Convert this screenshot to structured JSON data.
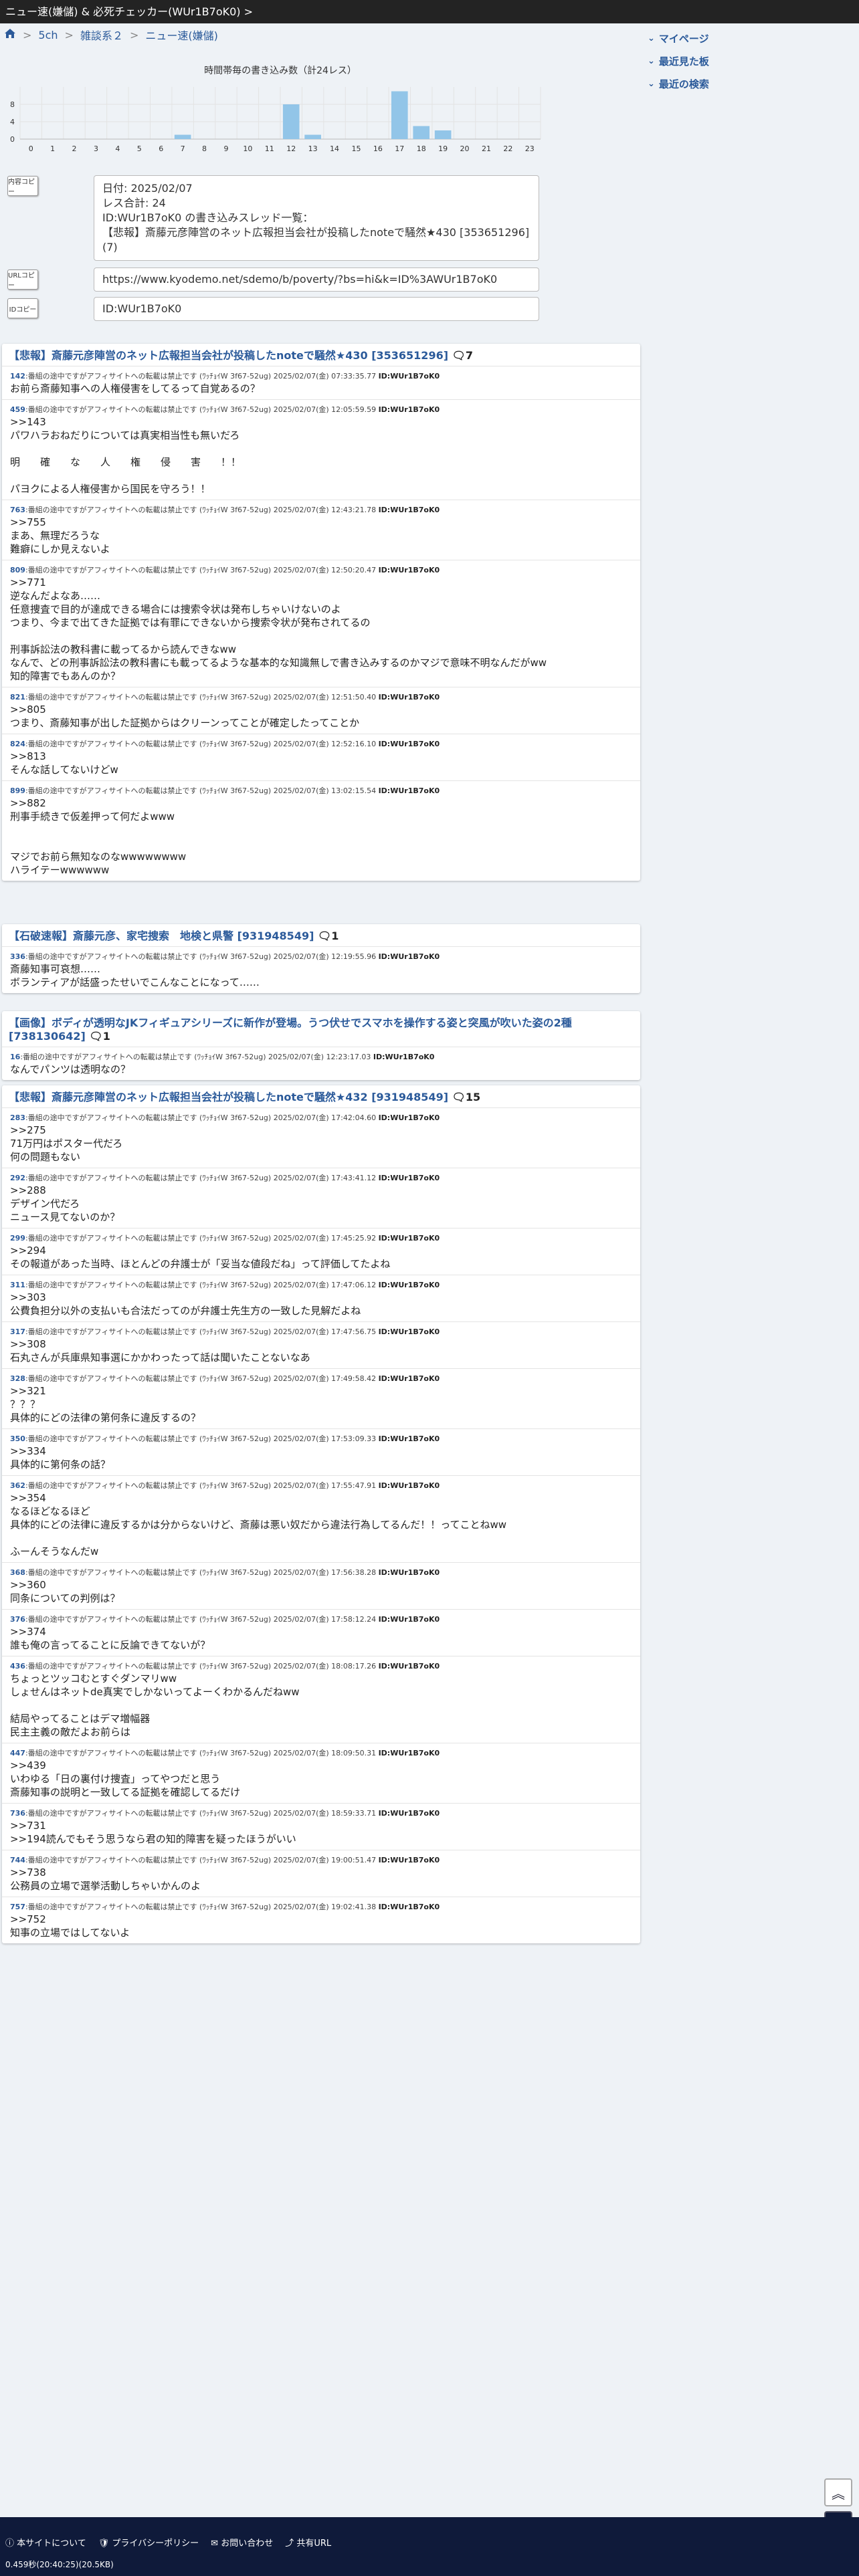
{
  "window": {
    "title": "ニュー速(嫌儲) & 必死チェッカー(WUr1B7oK0) >"
  },
  "breadcrumb": {
    "home_icon": "home-icon",
    "items": [
      "5ch",
      "雑談系２",
      "ニュー速(嫌儲)"
    ]
  },
  "rightmenu": {
    "items": [
      "マイページ",
      "最近見た板",
      "最近の検索"
    ]
  },
  "chart_data": {
    "type": "bar",
    "title": "時間帯毎の書き込み数（計24レス）",
    "categories": [
      "0",
      "1",
      "2",
      "3",
      "4",
      "5",
      "6",
      "7",
      "8",
      "9",
      "10",
      "11",
      "12",
      "13",
      "14",
      "15",
      "16",
      "17",
      "18",
      "19",
      "20",
      "21",
      "22",
      "23"
    ],
    "values": [
      0,
      0,
      0,
      0,
      0,
      0,
      0,
      1,
      0,
      0,
      0,
      0,
      8,
      1,
      0,
      0,
      0,
      11,
      3,
      2,
      0,
      0,
      0,
      0
    ],
    "yticks": [
      "0",
      "4",
      "8"
    ],
    "ylim": [
      0,
      12
    ],
    "grid": true
  },
  "tools": {
    "summary_icon": "内容コピー",
    "url_icon": "URLコピー",
    "id_icon": "IDコピー"
  },
  "summary": {
    "lines": [
      "日付: 2025/02/07",
      "レス合計: 24",
      "ID:WUr1B7oK0 の書き込みスレッド一覧：",
      "【悲報】斎藤元彦陣営のネット広報担当会社が投稿したnoteで騒然★430 [353651296] (7)"
    ]
  },
  "url": "https://www.kyodemo.net/sdemo/b/poverty/?bs=hi&k=ID%3AWUr1B7oK0",
  "id": "ID:WUr1B7oK0",
  "threads": [
    {
      "title": "【悲報】斎藤元彦陣営のネット広報担当会社が投稿したnoteで騒然★430 [353651296]",
      "count": "7",
      "posts": [
        {
          "num": "142",
          "meta": ":番組の途中ですがアフィサイトへの転載は禁止です (ﾜｯﾁｮｲW 3f67-52ug) 2025/02/07(金) 07:33:35.77",
          "pid": "ID:WUr1B7oK0",
          "body": "お前ら斎藤知事への人権侵害をしてるって自覚あるの？"
        },
        {
          "num": "459",
          "meta": ":番組の途中ですがアフィサイトへの転載は禁止です (ﾜｯﾁｮｲW 3f67-52ug) 2025/02/07(金) 12:05:59.59",
          "pid": "ID:WUr1B7oK0",
          "body": ">>143\nパワハラおねだりについては真実相当性も無いだろ\n\n明　　確　　な　　人　　権　　侵　　害　　！！\n\nパヨクによる人権侵害から国民を守ろう！！"
        },
        {
          "num": "763",
          "meta": ":番組の途中ですがアフィサイトへの転載は禁止です (ﾜｯﾁｮｲW 3f67-52ug) 2025/02/07(金) 12:43:21.78",
          "pid": "ID:WUr1B7oK0",
          "body": ">>755\nまあ、無理だろうな\n難癖にしか見えないよ"
        },
        {
          "num": "809",
          "meta": ":番組の途中ですがアフィサイトへの転載は禁止です (ﾜｯﾁｮｲW 3f67-52ug) 2025/02/07(金) 12:50:20.47",
          "pid": "ID:WUr1B7oK0",
          "body": ">>771\n逆なんだよなあ……\n任意捜査で目的が達成できる場合には捜索令状は発布しちゃいけないのよ\nつまり、今まで出てきた証拠では有罪にできないから捜索令状が発布されてるの\n\n刑事訴訟法の教科書に載ってるから読んできなww\nなんで、どの刑事訴訟法の教科書にも載ってるような基本的な知識無しで書き込みするのかマジで意味不明なんだがww\n知的障害でもあんのか？"
        },
        {
          "num": "821",
          "meta": ":番組の途中ですがアフィサイトへの転載は禁止です (ﾜｯﾁｮｲW 3f67-52ug) 2025/02/07(金) 12:51:50.40",
          "pid": "ID:WUr1B7oK0",
          "body": ">>805\nつまり、斎藤知事が出した証拠からはクリーンってことが確定したってことか"
        },
        {
          "num": "824",
          "meta": ":番組の途中ですがアフィサイトへの転載は禁止です (ﾜｯﾁｮｲW 3f67-52ug) 2025/02/07(金) 12:52:16.10",
          "pid": "ID:WUr1B7oK0",
          "body": ">>813\nそんな話してないけどw"
        },
        {
          "num": "899",
          "meta": ":番組の途中ですがアフィサイトへの転載は禁止です (ﾜｯﾁｮｲW 3f67-52ug) 2025/02/07(金) 13:02:15.54",
          "pid": "ID:WUr1B7oK0",
          "body": ">>882\n刑事手続きで仮差押って何だよwww\n\n\nマジでお前ら無知なのなwwwwwwww\nハライテーwwwwww"
        }
      ]
    },
    {
      "title": "【石破速報】斎藤元彦、家宅捜索　地検と県警 [931948549]",
      "count": "1",
      "posts": [
        {
          "num": "336",
          "meta": ":番組の途中ですがアフィサイトへの転載は禁止です (ﾜｯﾁｮｲW 3f67-52ug) 2025/02/07(金) 12:19:55.96",
          "pid": "ID:WUr1B7oK0",
          "body": "斎藤知事可哀想……\nボランティアが話盛ったせいでこんなことになって……"
        }
      ]
    },
    {
      "title": "【画像】ボディが透明なJKフィギュアシリーズに新作が登場。うつ伏せでスマホを操作する姿と突風が吹いた姿の2種 [738130642]",
      "count": "1",
      "posts": [
        {
          "num": "16",
          "meta": ":番組の途中ですがアフィサイトへの転載は禁止です (ﾜｯﾁｮｲW 3f67-52ug) 2025/02/07(金) 12:23:17.03",
          "pid": "ID:WUr1B7oK0",
          "body": "なんでパンツは透明なの？"
        }
      ]
    },
    {
      "title": "【悲報】斎藤元彦陣営のネット広報担当会社が投稿したnoteで騒然★432 [931948549]",
      "count": "15",
      "posts": [
        {
          "num": "283",
          "meta": ":番組の途中ですがアフィサイトへの転載は禁止です (ﾜｯﾁｮｲW 3f67-52ug) 2025/02/07(金) 17:42:04.60",
          "pid": "ID:WUr1B7oK0",
          "body": ">>275\n71万円はポスター代だろ\n何の問題もない"
        },
        {
          "num": "292",
          "meta": ":番組の途中ですがアフィサイトへの転載は禁止です (ﾜｯﾁｮｲW 3f67-52ug) 2025/02/07(金) 17:43:41.12",
          "pid": "ID:WUr1B7oK0",
          "body": ">>288\nデザイン代だろ\nニュース見てないのか？"
        },
        {
          "num": "299",
          "meta": ":番組の途中ですがアフィサイトへの転載は禁止です (ﾜｯﾁｮｲW 3f67-52ug) 2025/02/07(金) 17:45:25.92",
          "pid": "ID:WUr1B7oK0",
          "body": ">>294\nその報道があった当時、ほとんどの弁護士が「妥当な値段だね」って評価してたよね"
        },
        {
          "num": "311",
          "meta": ":番組の途中ですがアフィサイトへの転載は禁止です (ﾜｯﾁｮｲW 3f67-52ug) 2025/02/07(金) 17:47:06.12",
          "pid": "ID:WUr1B7oK0",
          "body": ">>303\n公費負担分以外の支払いも合法だってのが弁護士先生方の一致した見解だよね"
        },
        {
          "num": "317",
          "meta": ":番組の途中ですがアフィサイトへの転載は禁止です (ﾜｯﾁｮｲW 3f67-52ug) 2025/02/07(金) 17:47:56.75",
          "pid": "ID:WUr1B7oK0",
          "body": ">>308\n石丸さんが兵庫県知事選にかかわったって話は聞いたことないなあ"
        },
        {
          "num": "328",
          "meta": ":番組の途中ですがアフィサイトへの転載は禁止です (ﾜｯﾁｮｲW 3f67-52ug) 2025/02/07(金) 17:49:58.42",
          "pid": "ID:WUr1B7oK0",
          "body": ">>321\n？？？\n具体的にどの法律の第何条に違反するの？"
        },
        {
          "num": "350",
          "meta": ":番組の途中ですがアフィサイトへの転載は禁止です (ﾜｯﾁｮｲW 3f67-52ug) 2025/02/07(金) 17:53:09.33",
          "pid": "ID:WUr1B7oK0",
          "body": ">>334\n具体的に第何条の話？"
        },
        {
          "num": "362",
          "meta": ":番組の途中ですがアフィサイトへの転載は禁止です (ﾜｯﾁｮｲW 3f67-52ug) 2025/02/07(金) 17:55:47.91",
          "pid": "ID:WUr1B7oK0",
          "body": ">>354\nなるほどなるほど\n具体的にどの法律に違反するかは分からないけど、斎藤は悪い奴だから違法行為してるんだ！！ってことねww\n\nふーんそうなんだw"
        },
        {
          "num": "368",
          "meta": ":番組の途中ですがアフィサイトへの転載は禁止です (ﾜｯﾁｮｲW 3f67-52ug) 2025/02/07(金) 17:56:38.28",
          "pid": "ID:WUr1B7oK0",
          "body": ">>360\n同条についての判例は？"
        },
        {
          "num": "376",
          "meta": ":番組の途中ですがアフィサイトへの転載は禁止です (ﾜｯﾁｮｲW 3f67-52ug) 2025/02/07(金) 17:58:12.24",
          "pid": "ID:WUr1B7oK0",
          "body": ">>374\n誰も俺の言ってることに反論できてないが？"
        },
        {
          "num": "436",
          "meta": ":番組の途中ですがアフィサイトへの転載は禁止です (ﾜｯﾁｮｲW 3f67-52ug) 2025/02/07(金) 18:08:17.26",
          "pid": "ID:WUr1B7oK0",
          "body": "ちょっとツッコむとすぐダンマリww\nしょせんはネットde真実でしかないってよーくわかるんだねww\n\n結局やってることはデマ増幅器\n民主主義の敵だよお前らは"
        },
        {
          "num": "447",
          "meta": ":番組の途中ですがアフィサイトへの転載は禁止です (ﾜｯﾁｮｲW 3f67-52ug) 2025/02/07(金) 18:09:50.31",
          "pid": "ID:WUr1B7oK0",
          "body": ">>439\nいわゆる「日の裏付け捜査」ってやつだと思う\n斎藤知事の説明と一致してる証拠を確認してるだけ"
        },
        {
          "num": "736",
          "meta": ":番組の途中ですがアフィサイトへの転載は禁止です (ﾜｯﾁｮｲW 3f67-52ug) 2025/02/07(金) 18:59:33.71",
          "pid": "ID:WUr1B7oK0",
          "body": ">>731\n>>194読んでもそう思うなら君の知的障害を疑ったほうがいい"
        },
        {
          "num": "744",
          "meta": ":番組の途中ですがアフィサイトへの転載は禁止です (ﾜｯﾁｮｲW 3f67-52ug) 2025/02/07(金) 19:00:51.47",
          "pid": "ID:WUr1B7oK0",
          "body": ">>738\n公務員の立場で選挙活動しちゃいかんのよ"
        },
        {
          "num": "757",
          "meta": ":番組の途中ですがアフィサイトへの転載は禁止です (ﾜｯﾁｮｲW 3f67-52ug) 2025/02/07(金) 19:02:41.38",
          "pid": "ID:WUr1B7oK0",
          "body": ">>752\n知事の立場ではしてないよ"
        }
      ]
    }
  ],
  "footer": {
    "links": [
      "本サイトについて",
      "プライバシーポリシー",
      "お問い合わせ",
      "共有URL"
    ],
    "time": "0.459秒(20:40:25)(20.5KB)"
  },
  "fab": {
    "top_icon": "chevron-up-double-icon"
  },
  "colors": {
    "link": "#2b5a9a",
    "bar": "#92c5e8",
    "footer": "#0f1a3a"
  }
}
